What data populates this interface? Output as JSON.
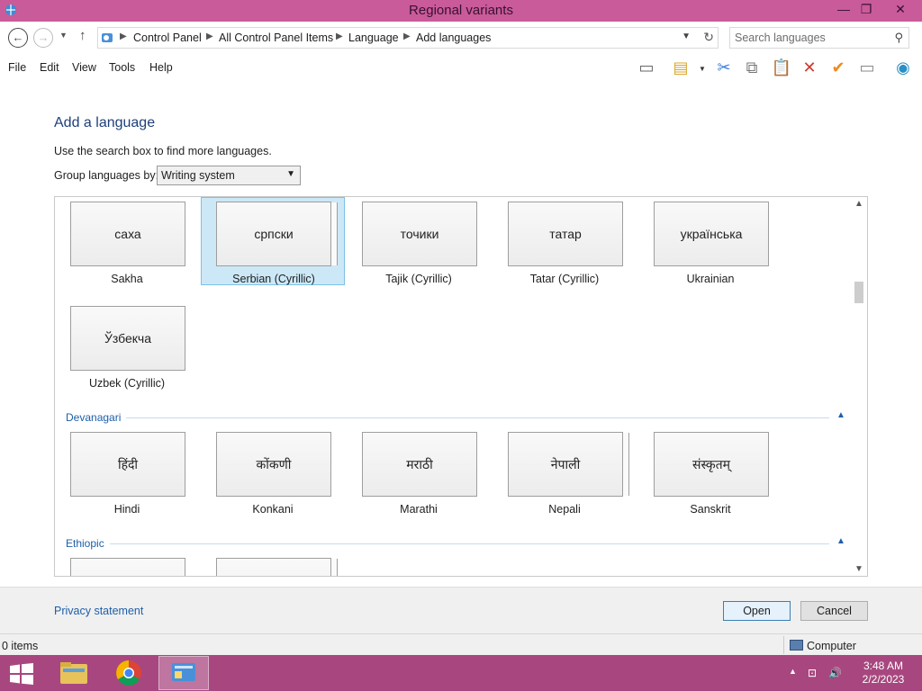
{
  "window": {
    "title": "Regional variants",
    "buttons": {
      "minimize": "—",
      "restore": "❐",
      "close": "✕"
    }
  },
  "nav": {
    "breadcrumbs": [
      "Control Panel",
      "All Control Panel Items",
      "Language",
      "Add languages"
    ],
    "search_placeholder": "Search languages"
  },
  "menu": [
    "File",
    "Edit",
    "View",
    "Tools",
    "Help"
  ],
  "toolbar_icons": [
    "layout-icon",
    "properties-icon",
    "cut-icon",
    "copy-icon",
    "paste-icon",
    "delete-icon",
    "check-icon",
    "rename-icon",
    "network-icon"
  ],
  "page": {
    "heading": "Add a language",
    "hint": "Use the search box to find more languages.",
    "group_label": "Group languages by:",
    "group_value": "Writing system"
  },
  "rows": {
    "cyrillic_row1": [
      {
        "native": "саха",
        "name": "Sakha",
        "stacked": false,
        "selected": false
      },
      {
        "native": "српски",
        "name": "Serbian (Cyrillic)",
        "stacked": true,
        "selected": true
      },
      {
        "native": "точики",
        "name": "Tajik (Cyrillic)",
        "stacked": false,
        "selected": false
      },
      {
        "native": "татар",
        "name": "Tatar (Cyrillic)",
        "stacked": false,
        "selected": false
      },
      {
        "native": "українська",
        "name": "Ukrainian",
        "stacked": false,
        "selected": false
      }
    ],
    "cyrillic_row2": [
      {
        "native": "Ўзбекча",
        "name": "Uzbek (Cyrillic)",
        "stacked": false,
        "selected": false
      }
    ],
    "devanagari": [
      {
        "native": "हिंदी",
        "name": "Hindi",
        "stacked": false,
        "selected": false
      },
      {
        "native": "कोंकणी",
        "name": "Konkani",
        "stacked": false,
        "selected": false
      },
      {
        "native": "मराठी",
        "name": "Marathi",
        "stacked": false,
        "selected": false
      },
      {
        "native": "नेपाली",
        "name": "Nepali",
        "stacked": true,
        "selected": false
      },
      {
        "native": "संस्कृतम्",
        "name": "Sanskrit",
        "stacked": false,
        "selected": false
      }
    ]
  },
  "sections": {
    "devanagari": "Devanagari",
    "ethiopic": "Ethiopic"
  },
  "actions": {
    "privacy": "Privacy statement",
    "open": "Open",
    "cancel": "Cancel"
  },
  "status": {
    "items": "0 items",
    "location": "Computer"
  },
  "taskbar": {
    "time": "3:48 AM",
    "date": "2/2/2023"
  },
  "colors": {
    "titlebar": "#c95b9a",
    "taskbar": "#a8477f",
    "accent": "#1e5fa8",
    "selection": "#cce8f7"
  }
}
